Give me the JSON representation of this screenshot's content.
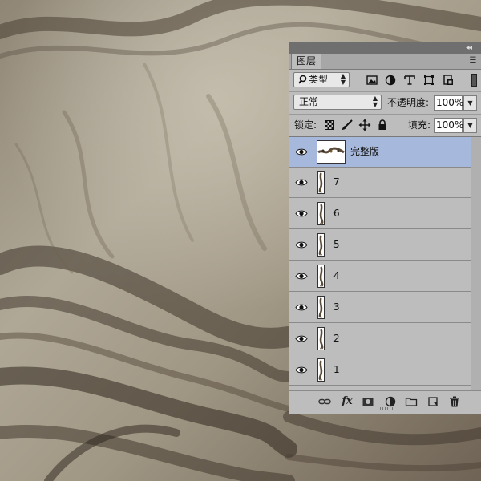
{
  "panel": {
    "tab_label": "图层",
    "collapse_icon": "double-chevron-icon",
    "menu_icon": "panel-menu-icon"
  },
  "filter": {
    "kind_label": "类型",
    "icons": [
      "image-filter-icon",
      "adjustment-filter-icon",
      "type-filter-icon",
      "shape-filter-icon",
      "smart-object-filter-icon"
    ]
  },
  "blend": {
    "mode": "正常",
    "opacity_label": "不透明度:",
    "opacity_value": "100%"
  },
  "lock": {
    "label": "锁定:",
    "fill_label": "填充:",
    "fill_value": "100%",
    "icons": [
      "lock-transparent-icon",
      "lock-brush-icon",
      "lock-move-icon",
      "lock-all-icon"
    ]
  },
  "layers": [
    {
      "name": "完整版",
      "selected": true,
      "thumb": "wide"
    },
    {
      "name": "7",
      "selected": false,
      "thumb": "narrow"
    },
    {
      "name": "6",
      "selected": false,
      "thumb": "narrow"
    },
    {
      "name": "5",
      "selected": false,
      "thumb": "narrow"
    },
    {
      "name": "4",
      "selected": false,
      "thumb": "narrow"
    },
    {
      "name": "3",
      "selected": false,
      "thumb": "narrow"
    },
    {
      "name": "2",
      "selected": false,
      "thumb": "narrow"
    },
    {
      "name": "1",
      "selected": false,
      "thumb": "narrow"
    }
  ],
  "bottom": {
    "fx_label": "fx",
    "icons": [
      "link-icon",
      "fx-icon",
      "mask-icon",
      "adjustment-icon",
      "folder-icon",
      "new-layer-icon",
      "trash-icon"
    ]
  },
  "colors": {
    "selected_row": "#a6b8dc",
    "panel_bg": "#bdbdbd",
    "canvas": "#a49c8c"
  }
}
